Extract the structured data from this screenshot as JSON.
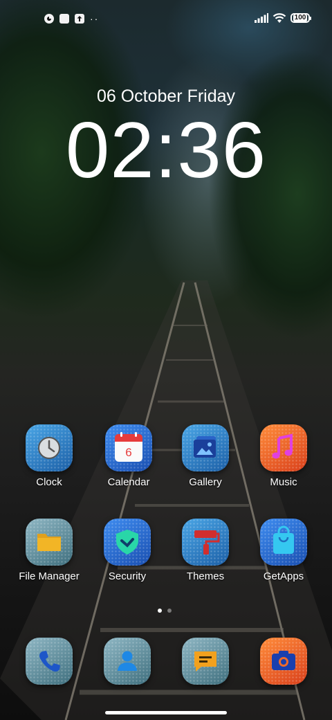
{
  "status_bar": {
    "left_icons": [
      "notification-icon",
      "square-notification-icon",
      "upload-icon",
      "more-dots-icon"
    ],
    "right_icons": [
      "signal-icon",
      "wifi-icon",
      "battery-icon"
    ],
    "battery_level": "100",
    "more_dots": "··"
  },
  "lock_clock": {
    "date": "06 October Friday",
    "time": "02:36"
  },
  "apps": [
    {
      "label": "Clock",
      "icon": "clock-icon"
    },
    {
      "label": "Calendar",
      "icon": "calendar-icon",
      "day": "6"
    },
    {
      "label": "Gallery",
      "icon": "gallery-icon"
    },
    {
      "label": "Music",
      "icon": "music-icon"
    },
    {
      "label": "File Manager",
      "icon": "folder-icon"
    },
    {
      "label": "Security",
      "icon": "shield-icon"
    },
    {
      "label": "Themes",
      "icon": "paint-roller-icon"
    },
    {
      "label": "GetApps",
      "icon": "shopping-bag-icon"
    }
  ],
  "dock": [
    {
      "icon": "phone-icon"
    },
    {
      "icon": "contacts-icon"
    },
    {
      "icon": "messages-icon"
    },
    {
      "icon": "camera-icon"
    }
  ],
  "page_indicator": {
    "current": 1,
    "total": 2
  },
  "colors": {
    "accent_blue": "#2f7fd6",
    "accent_orange": "#ef6a2a",
    "tile_teal": "#6a98a6"
  }
}
